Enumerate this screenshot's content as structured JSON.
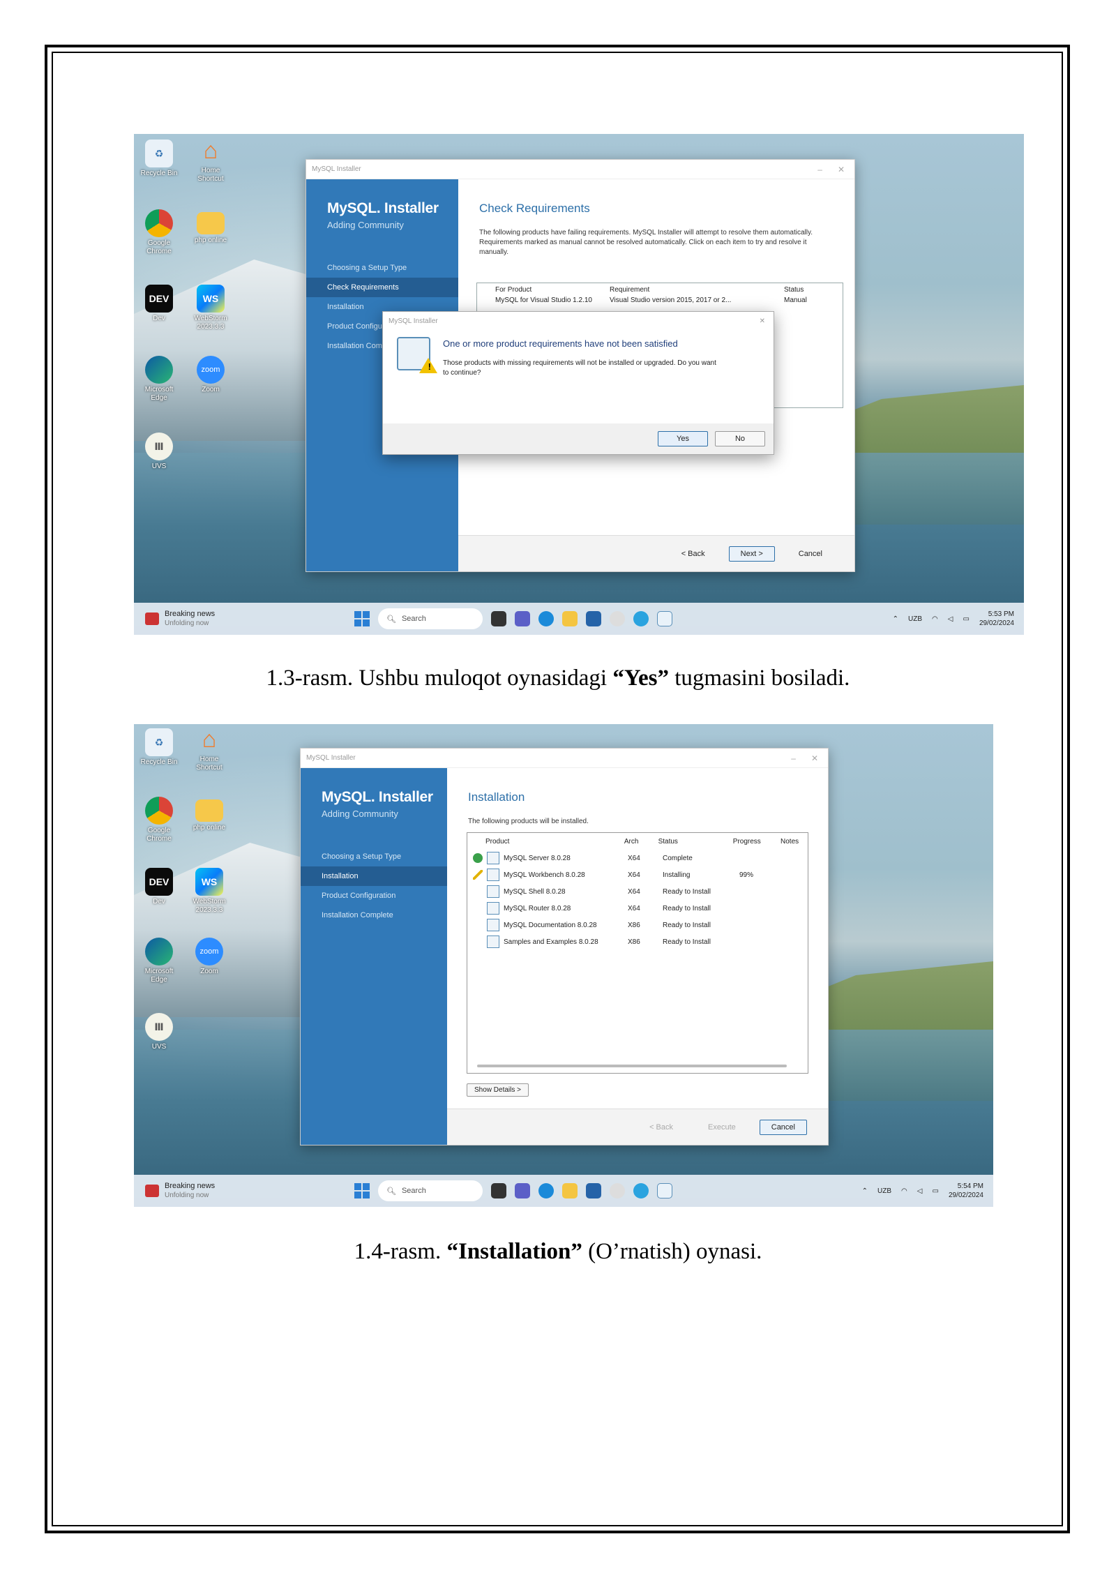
{
  "figure1": {
    "window_title": "MySQL Installer",
    "brand": "MySQL. Installer",
    "brand_sub": "Adding Community",
    "steps": [
      "Choosing a Setup Type",
      "Check Requirements",
      "Installation",
      "Product Configuration",
      "Installation Complete"
    ],
    "active_step": 1,
    "heading": "Check Requirements",
    "description": "The following products have failing requirements. MySQL Installer will attempt to resolve them automatically. Requirements marked as manual cannot be resolved automatically. Click on each item to try and resolve it manually.",
    "table_headers": [
      "For Product",
      "Requirement",
      "Status"
    ],
    "table_row": [
      "MySQL for Visual Studio 1.2.10",
      "Visual Studio version 2015, 2017 or 2...",
      "Manual"
    ],
    "dialog": {
      "title": "MySQL Installer",
      "heading": "One or more product requirements have not been satisfied",
      "body": "Those products with missing requirements will not be installed or upgraded. Do you want to continue?",
      "yes": "Yes",
      "no": "No"
    },
    "back": "< Back",
    "next": "Next >",
    "cancel": "Cancel",
    "clock_time": "5:53 PM",
    "clock_date": "29/02/2024"
  },
  "caption1": {
    "before": "1.3-rasm. Ushbu muloqot oynasidagi ",
    "bold": "“Yes”",
    "after": " tugmasini bosiladi."
  },
  "figure2": {
    "window_title": "MySQL Installer",
    "brand": "MySQL. Installer",
    "brand_sub": "Adding Community",
    "steps": [
      "Choosing a Setup Type",
      "Installation",
      "Product Configuration",
      "Installation Complete"
    ],
    "active_step": 1,
    "heading": "Installation",
    "description": "The following products will be installed.",
    "columns": [
      "Product",
      "Arch",
      "Status",
      "Progress",
      "Notes"
    ],
    "rows": [
      {
        "product": "MySQL Server 8.0.28",
        "arch": "X64",
        "status": "Complete",
        "progress": "",
        "state": "ok"
      },
      {
        "product": "MySQL Workbench 8.0.28",
        "arch": "X64",
        "status": "Installing",
        "progress": "99%",
        "state": "pen"
      },
      {
        "product": "MySQL Shell 8.0.28",
        "arch": "X64",
        "status": "Ready to Install",
        "progress": "",
        "state": ""
      },
      {
        "product": "MySQL Router 8.0.28",
        "arch": "X64",
        "status": "Ready to Install",
        "progress": "",
        "state": ""
      },
      {
        "product": "MySQL Documentation 8.0.28",
        "arch": "X86",
        "status": "Ready to Install",
        "progress": "",
        "state": ""
      },
      {
        "product": "Samples and Examples 8.0.28",
        "arch": "X86",
        "status": "Ready to Install",
        "progress": "",
        "state": ""
      }
    ],
    "show_details": "Show Details >",
    "back": "< Back",
    "execute": "Execute",
    "cancel": "Cancel",
    "clock_time": "5:54 PM",
    "clock_date": "29/02/2024"
  },
  "caption2": {
    "before": "1.4-rasm. ",
    "bold": "“Installation”",
    "after": " (O’rnatish) oynasi."
  },
  "taskbar": {
    "news_title": "Breaking news",
    "news_sub": "Unfolding now",
    "search": "Search",
    "lang": "UZB"
  },
  "desktop_icons": [
    "Recycle Bin",
    "Home Shortcut",
    "Google Chrome",
    "php online",
    "Dev",
    "WebStorm 2023.3.3",
    "Microsoft Edge",
    "Zoom",
    "UVS"
  ]
}
